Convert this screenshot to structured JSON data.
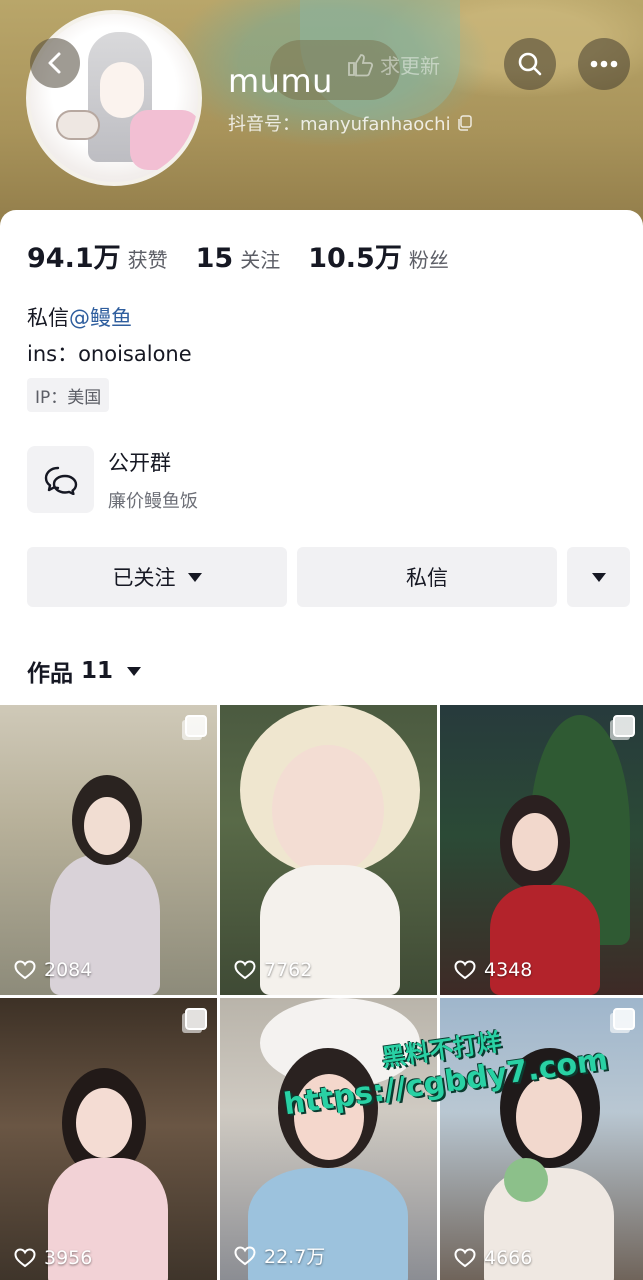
{
  "header": {
    "nickname": "mumu",
    "update_hint": "求更新",
    "douyin_id": "抖音号：manyufanhaochi"
  },
  "stats": [
    {
      "value": "94.1万",
      "label": "获赞"
    },
    {
      "value": "15",
      "label": "关注"
    },
    {
      "value": "10.5万",
      "label": "粉丝"
    }
  ],
  "bio": {
    "line1_prefix": "私信",
    "line1_mention": "@鳗鱼",
    "line2": "ins：onoisalone",
    "ip": "IP：美国"
  },
  "group": {
    "title": "公开群",
    "subtitle": "廉价鳗鱼饭"
  },
  "buttons": {
    "follow": "已关注",
    "message": "私信"
  },
  "works": {
    "label": "作品",
    "count": "11"
  },
  "posts": [
    {
      "likes": "2084"
    },
    {
      "likes": "7762"
    },
    {
      "likes": "4348"
    },
    {
      "likes": "3956"
    },
    {
      "likes": "22.7万"
    },
    {
      "likes": "4666"
    }
  ],
  "watermark": {
    "line1": "黑料不打烊",
    "line2": "https://cgbdy7.com"
  }
}
